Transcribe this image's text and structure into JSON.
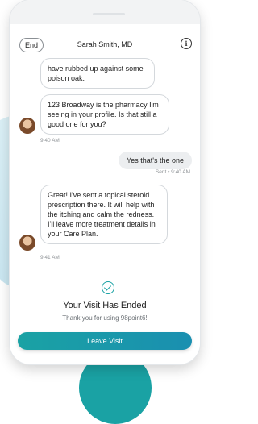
{
  "header": {
    "end_label": "End",
    "title": "Sarah Smith, MD",
    "info_icon": "i"
  },
  "messages": [
    {
      "text": "have rubbed up against some poison oak."
    },
    {
      "text": "123 Broadway is the pharmacy I'm seeing in your profile. Is that still a good one for you?",
      "time": "9:40 AM"
    },
    {
      "text": "Yes that's the one",
      "time": "Sent • 9:40 AM"
    },
    {
      "text": "Great! I've sent a topical steroid prescription there. It will help with the itching and calm the redness. I'll leave more treatment details in your Care Plan.",
      "time": "9:41 AM"
    }
  ],
  "ended": {
    "title": "Your Visit Has Ended",
    "subtitle": "Thank you for using 98point6!"
  },
  "leave_button": "Leave Visit",
  "colors": {
    "accent": "#1aa2a4"
  }
}
